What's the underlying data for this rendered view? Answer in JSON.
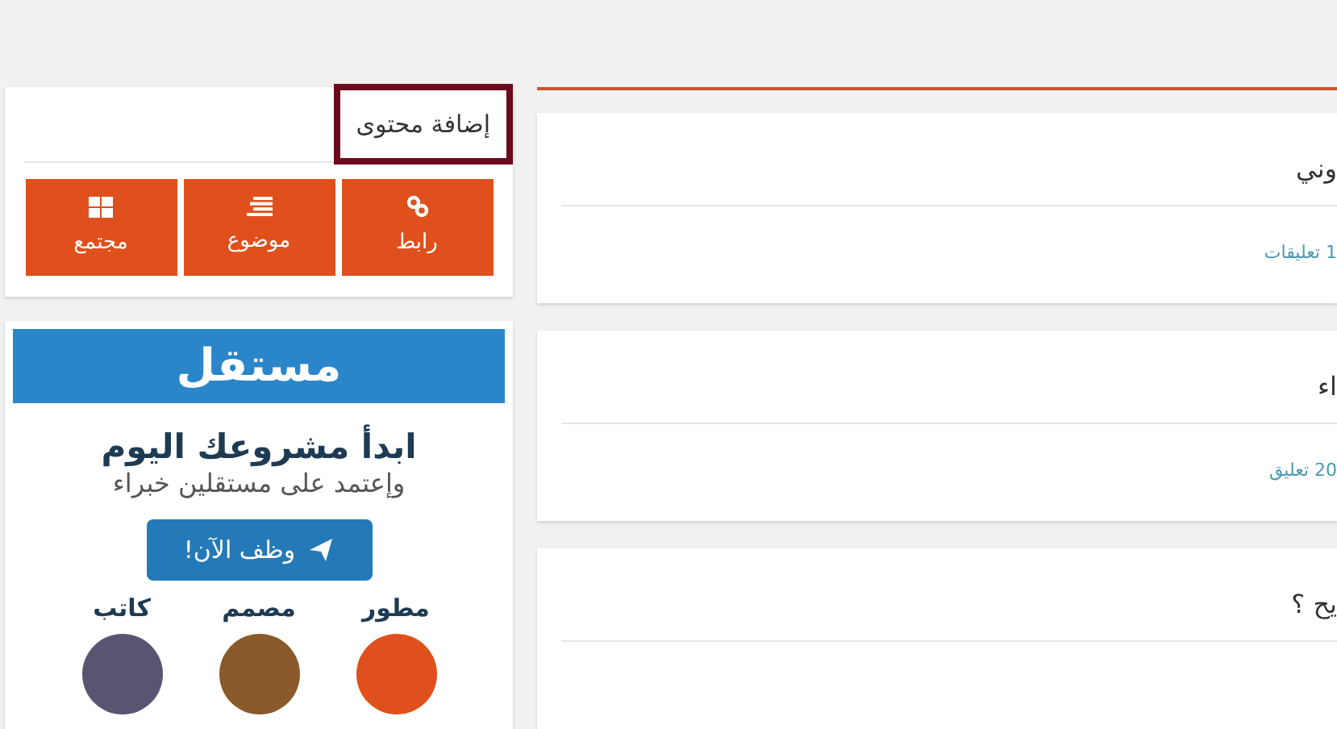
{
  "add_content": {
    "title": "إضافة محتوى",
    "buttons": [
      {
        "kind": "link",
        "label": "رابط"
      },
      {
        "kind": "topic",
        "label": "موضوع"
      },
      {
        "kind": "community",
        "label": "مجتمع"
      }
    ]
  },
  "ad": {
    "logo": "مستقل",
    "headline": "ابدأ مشروعك اليوم",
    "subline": "وإعتمد على مستقلين خبراء",
    "cta": "وظف الآن!",
    "roles": [
      {
        "label": "مطور",
        "color": "#e0501c"
      },
      {
        "label": "مصمم",
        "color": "#8a5a2b"
      },
      {
        "label": "كاتب",
        "color": "#5a5470"
      }
    ]
  },
  "posts": [
    {
      "title": "وني",
      "comments": "1 تعليقات"
    },
    {
      "title": "اء",
      "comments": "20 تعليق"
    },
    {
      "title": "يح ؟"
    }
  ]
}
